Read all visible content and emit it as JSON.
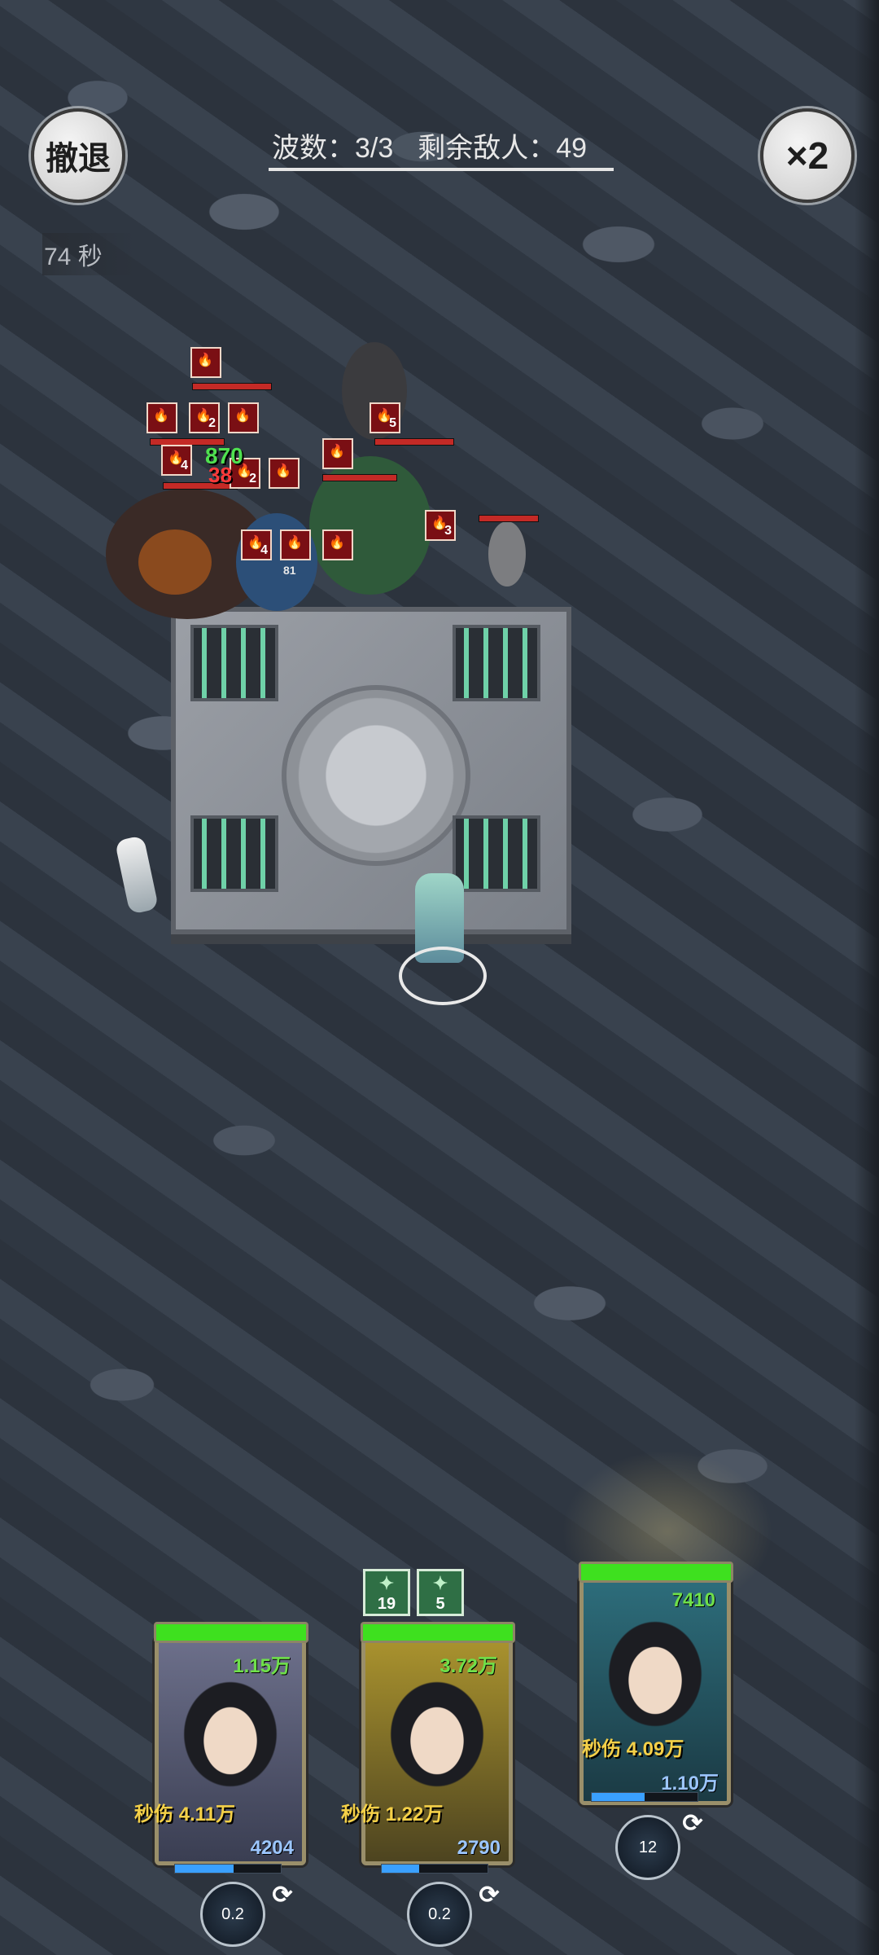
{
  "hud": {
    "retreat_label": "撤退",
    "speed_label": "×2",
    "wave_text": "波数：3/3",
    "remaining_text": "剩余敌人：49",
    "timer_text": "74 秒"
  },
  "battle": {
    "enemy_stack_counts": [
      "2",
      "4",
      "2",
      "5",
      "4",
      "3"
    ],
    "damage_numbers": [
      "870",
      "38"
    ],
    "minor_label": "81"
  },
  "heroes": [
    {
      "hp_text": "1.15万",
      "dps_text": "秒伤 4.11万",
      "mana_text": "4204",
      "skill_cd": "0.2",
      "hp_fill": 1.0,
      "mp_fill": 0.55
    },
    {
      "hp_text": "3.72万",
      "dps_text": "秒伤 1.22万",
      "mana_text": "2790",
      "skill_cd": "0.2",
      "hp_fill": 1.0,
      "mp_fill": 0.35
    },
    {
      "hp_text": "7410",
      "dps_text": "秒伤 4.09万",
      "mana_text": "1.10万",
      "skill_cd": "12",
      "hp_fill": 1.0,
      "mp_fill": 0.5
    }
  ],
  "hero_buffs": [
    "19",
    "5"
  ],
  "colors": {
    "hp_green": "#3ee01f",
    "dps_yellow": "#f4d048",
    "mana_blue": "#3aa0ff"
  }
}
